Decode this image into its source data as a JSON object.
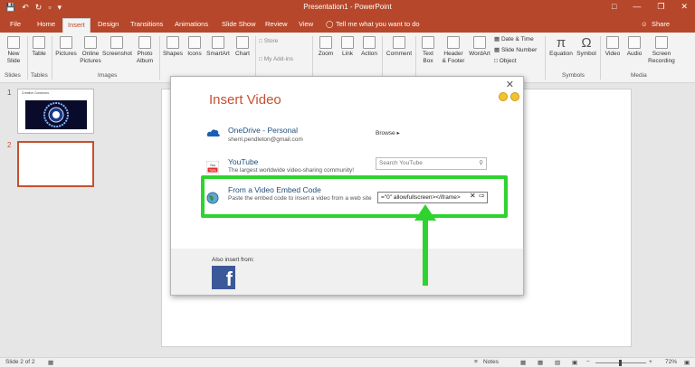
{
  "window": {
    "title": "Presentation1 - PowerPoint"
  },
  "tabs": [
    "File",
    "Home",
    "Insert",
    "Design",
    "Transitions",
    "Animations",
    "Slide Show",
    "Review",
    "View"
  ],
  "tell_me": "Tell me what you want to do",
  "share": "Share",
  "ribbon": {
    "new_slide": [
      "New",
      "Slide"
    ],
    "table": "Table",
    "pictures": "Pictures",
    "online_pictures": [
      "Online",
      "Pictures"
    ],
    "screenshot": "Screenshot",
    "photo_album": [
      "Photo",
      "Album"
    ],
    "shapes": "Shapes",
    "icons": "Icons",
    "smartart": "SmartArt",
    "chart": "Chart",
    "store": "Store",
    "my_addins": "My Add-ins",
    "zoom": "Zoom",
    "link": "Link",
    "action": "Action",
    "comment": "Comment",
    "text_box": [
      "Text",
      "Box"
    ],
    "header_footer": [
      "Header",
      "& Footer"
    ],
    "wordart": "WordArt",
    "date_time": "Date & Time",
    "slide_number": "Slide Number",
    "object": "Object",
    "equation": "Equation",
    "symbol": "Symbol",
    "video": "Video",
    "audio": "Audio",
    "screen_recording": [
      "Screen",
      "Recording"
    ],
    "groups": [
      "Slides",
      "Tables",
      "Images",
      "Symbols",
      "Media"
    ]
  },
  "thumbnails": [
    {
      "number": "1",
      "header": "Creative Commons"
    },
    {
      "number": "2"
    }
  ],
  "dialog": {
    "title": "Insert Video",
    "onedrive": {
      "name": "OneDrive - Personal",
      "email": "sherri.pendleton@gmail.com",
      "action": "Browse"
    },
    "youtube": {
      "name": "YouTube",
      "desc": "The largest worldwide video-sharing community!",
      "placeholder": "Search YouTube"
    },
    "embed": {
      "name": "From a Video Embed Code",
      "desc": "Paste the embed code to insert a video from a web site",
      "value": "=\"0\" allowfullscreen></iframe>"
    },
    "also_insert": "Also insert from:"
  },
  "status": {
    "slide": "Slide 2 of 2",
    "notes": "Notes",
    "zoom": "72%"
  },
  "colors": {
    "brand": "#b7472a",
    "highlight": "#2fd32f",
    "facebook": "#3b5998"
  }
}
